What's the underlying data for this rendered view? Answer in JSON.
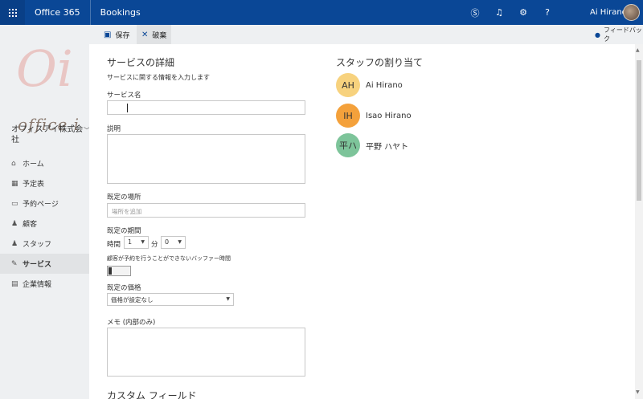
{
  "topbar": {
    "brand": "Office 365",
    "app": "Bookings",
    "user_name": "Ai Hirano",
    "icons": [
      "skype-icon",
      "bell-icon",
      "gear-icon",
      "help-icon"
    ]
  },
  "sidebar": {
    "org_name": "オフィスアイ株式会社",
    "items": [
      {
        "label": "ホーム",
        "icon": "home-icon"
      },
      {
        "label": "予定表",
        "icon": "calendar-icon"
      },
      {
        "label": "予約ページ",
        "icon": "laptop-icon"
      },
      {
        "label": "顧客",
        "icon": "person-icon"
      },
      {
        "label": "スタッフ",
        "icon": "people-icon"
      },
      {
        "label": "サービス",
        "icon": "wrench-icon"
      },
      {
        "label": "企業情報",
        "icon": "briefcase-icon"
      }
    ]
  },
  "command_bar": {
    "save_label": "保存",
    "discard_label": "破棄",
    "feedback_label": "フィードバック"
  },
  "service": {
    "title": "サービスの詳細",
    "subtitle": "サービスに関する情報を入力します",
    "name_label": "サービス名",
    "name_value": "",
    "description_label": "説明",
    "location_label": "既定の場所",
    "location_placeholder": "場所を追加",
    "duration_label": "既定の期間",
    "hours_label": "時間",
    "hours_value": "1",
    "minutes_label": "分",
    "minutes_value": "0",
    "buffer_label": "顧客が予約を行うことができないバッファー時間",
    "price_label": "既定の価格",
    "price_value": "価格が設定なし",
    "notes_label": "メモ (内部のみ)",
    "custom_fields_title": "カスタム フィールド"
  },
  "staff": {
    "title": "スタッフの割り当て",
    "members": [
      {
        "initials": "AH",
        "name": "Ai Hirano",
        "color": "#f7d27e"
      },
      {
        "initials": "IH",
        "name": "Isao Hirano",
        "color": "#f4a13b"
      },
      {
        "initials": "平ハ",
        "name": "平野 ハヤト",
        "color": "#7dc49a"
      }
    ]
  },
  "logo": {
    "text_large": "Oi",
    "text_small": "office i"
  }
}
